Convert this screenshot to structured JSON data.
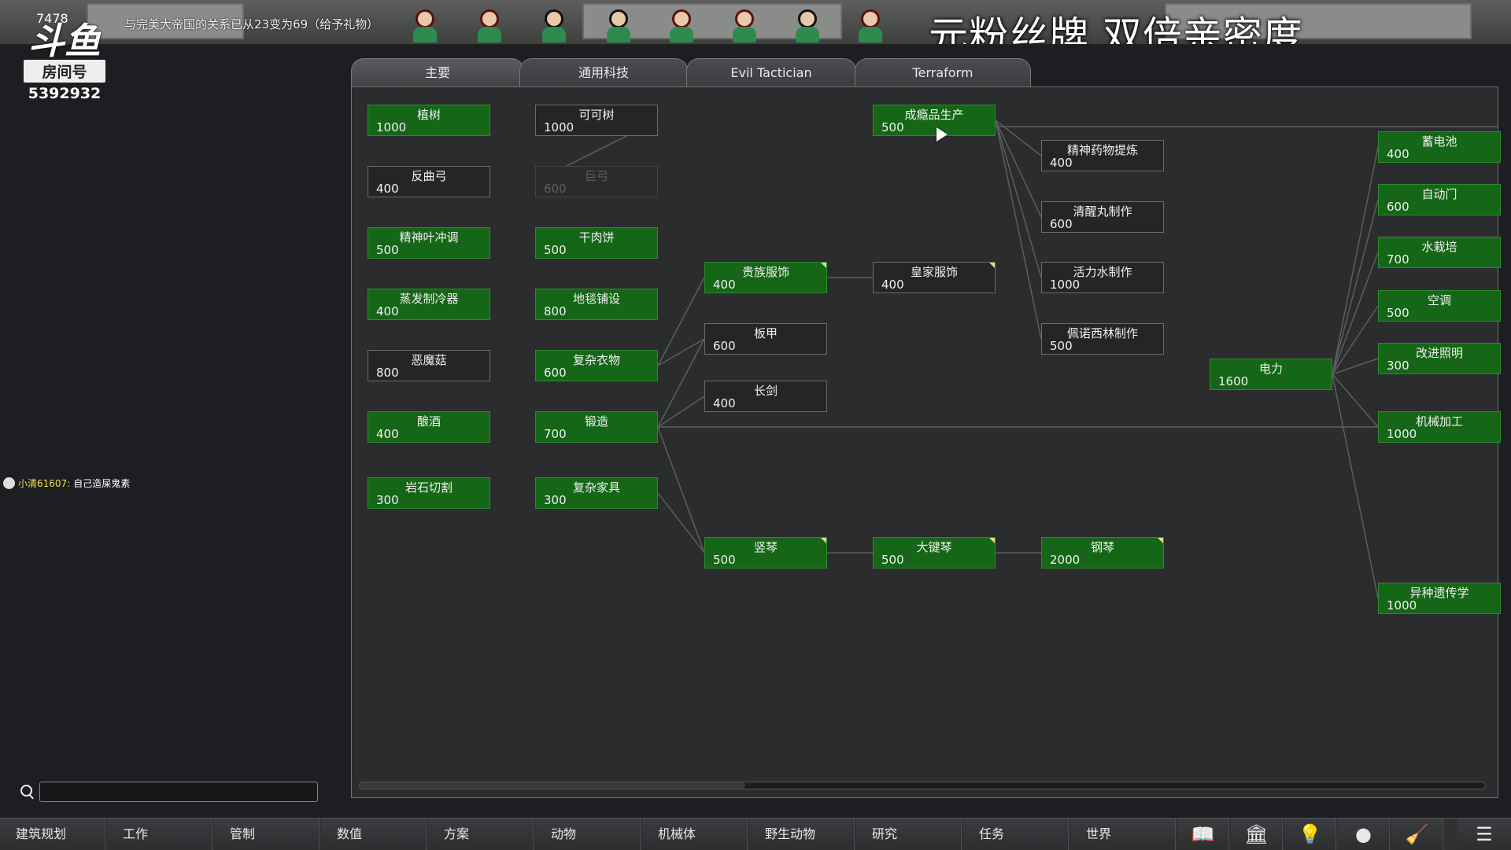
{
  "topbar": {
    "colonist_count": "7478",
    "relation_message": "与完美大帝国的关系已从23变为69（给予礼物）",
    "promo_text": "元粉丝牌 双倍亲密度"
  },
  "overlay": {
    "logo_text": "斗鱼",
    "room_label": "房间号",
    "room_number": "5392932"
  },
  "chat": {
    "user": "小清61607:",
    "message": "自己造屎鬼素"
  },
  "tabs": [
    {
      "label": "主要",
      "active": true
    },
    {
      "label": "通用科技",
      "active": false
    },
    {
      "label": "Evil Tactician",
      "active": false
    },
    {
      "label": "Terraform",
      "active": false
    }
  ],
  "research": [
    {
      "id": "n1",
      "name": "植树",
      "cost": "1000",
      "state": "done"
    },
    {
      "id": "n2",
      "name": "反曲弓",
      "cost": "400",
      "state": "open"
    },
    {
      "id": "n3",
      "name": "精神叶冲调",
      "cost": "500",
      "state": "done"
    },
    {
      "id": "n4",
      "name": "蒸发制冷器",
      "cost": "400",
      "state": "done"
    },
    {
      "id": "n5",
      "name": "恶魔菇",
      "cost": "800",
      "state": "open"
    },
    {
      "id": "n6",
      "name": "酿酒",
      "cost": "400",
      "state": "done"
    },
    {
      "id": "n7",
      "name": "岩石切割",
      "cost": "300",
      "state": "done"
    },
    {
      "id": "n8",
      "name": "可可树",
      "cost": "1000",
      "state": "open"
    },
    {
      "id": "n9",
      "name": "巨弓",
      "cost": "600",
      "state": "locked"
    },
    {
      "id": "n10",
      "name": "干肉饼",
      "cost": "500",
      "state": "done"
    },
    {
      "id": "n11",
      "name": "地毯铺设",
      "cost": "800",
      "state": "done"
    },
    {
      "id": "n12",
      "name": "复杂衣物",
      "cost": "600",
      "state": "done"
    },
    {
      "id": "n13",
      "name": "锻造",
      "cost": "700",
      "state": "done"
    },
    {
      "id": "n14",
      "name": "复杂家具",
      "cost": "300",
      "state": "done"
    },
    {
      "id": "n15",
      "name": "贵族服饰",
      "cost": "400",
      "state": "done",
      "flag": true
    },
    {
      "id": "n16",
      "name": "板甲",
      "cost": "600",
      "state": "open"
    },
    {
      "id": "n17",
      "name": "长剑",
      "cost": "400",
      "state": "open"
    },
    {
      "id": "n18",
      "name": "竖琴",
      "cost": "500",
      "state": "done",
      "flag": true
    },
    {
      "id": "n19",
      "name": "成瘾品生产",
      "cost": "500",
      "state": "done"
    },
    {
      "id": "n20",
      "name": "皇家服饰",
      "cost": "400",
      "state": "open",
      "flag": true
    },
    {
      "id": "n21",
      "name": "大键琴",
      "cost": "500",
      "state": "done",
      "flag": true
    },
    {
      "id": "n22",
      "name": "精神药物提炼",
      "cost": "400",
      "state": "open"
    },
    {
      "id": "n23",
      "name": "清醒丸制作",
      "cost": "600",
      "state": "open"
    },
    {
      "id": "n24",
      "name": "活力水制作",
      "cost": "1000",
      "state": "open"
    },
    {
      "id": "n25",
      "name": "佩诺西林制作",
      "cost": "500",
      "state": "open"
    },
    {
      "id": "n26",
      "name": "钢琴",
      "cost": "2000",
      "state": "done",
      "flag": true
    },
    {
      "id": "n27",
      "name": "电力",
      "cost": "1600",
      "state": "done"
    },
    {
      "id": "n28",
      "name": "蓄电池",
      "cost": "400",
      "state": "done"
    },
    {
      "id": "n29",
      "name": "自动门",
      "cost": "600",
      "state": "done"
    },
    {
      "id": "n30",
      "name": "水栽培",
      "cost": "700",
      "state": "done"
    },
    {
      "id": "n31",
      "name": "空调",
      "cost": "500",
      "state": "done"
    },
    {
      "id": "n32",
      "name": "改进照明",
      "cost": "300",
      "state": "done"
    },
    {
      "id": "n33",
      "name": "机械加工",
      "cost": "1000",
      "state": "done"
    },
    {
      "id": "n34",
      "name": "异种遗传学",
      "cost": "1000",
      "state": "done"
    }
  ],
  "links": [
    [
      "n8",
      "n9"
    ],
    [
      "n12",
      "n15"
    ],
    [
      "n12",
      "n16"
    ],
    [
      "n13",
      "n16"
    ],
    [
      "n13",
      "n17"
    ],
    [
      "n13",
      "n18"
    ],
    [
      "n13",
      "n33"
    ],
    [
      "n14",
      "n18"
    ],
    [
      "n18",
      "n21"
    ],
    [
      "n21",
      "n26"
    ],
    [
      "n15",
      "n20"
    ],
    [
      "n19",
      "n22"
    ],
    [
      "n19",
      "n23"
    ],
    [
      "n19",
      "n24"
    ],
    [
      "n19",
      "n25"
    ],
    [
      "n27",
      "n28"
    ],
    [
      "n27",
      "n29"
    ],
    [
      "n27",
      "n30"
    ],
    [
      "n27",
      "n31"
    ],
    [
      "n27",
      "n32"
    ],
    [
      "n27",
      "n33"
    ],
    [
      "n27",
      "n34"
    ]
  ],
  "search": {
    "value": "",
    "placeholder": ""
  },
  "bottombar": [
    "建筑规划",
    "工作",
    "管制",
    "数值",
    "方案",
    "动物",
    "机械体",
    "野生动物",
    "研究",
    "任务",
    "世界"
  ],
  "bottom_icons": [
    "book-icon",
    "factory-icon",
    "lightbulb-icon",
    "helmet-icon",
    "broom-icon",
    "list-menu-icon"
  ],
  "colors": {
    "done": "#156617",
    "open": "#242526",
    "locked": "#2a2b2c",
    "line": "#5c5e60"
  }
}
